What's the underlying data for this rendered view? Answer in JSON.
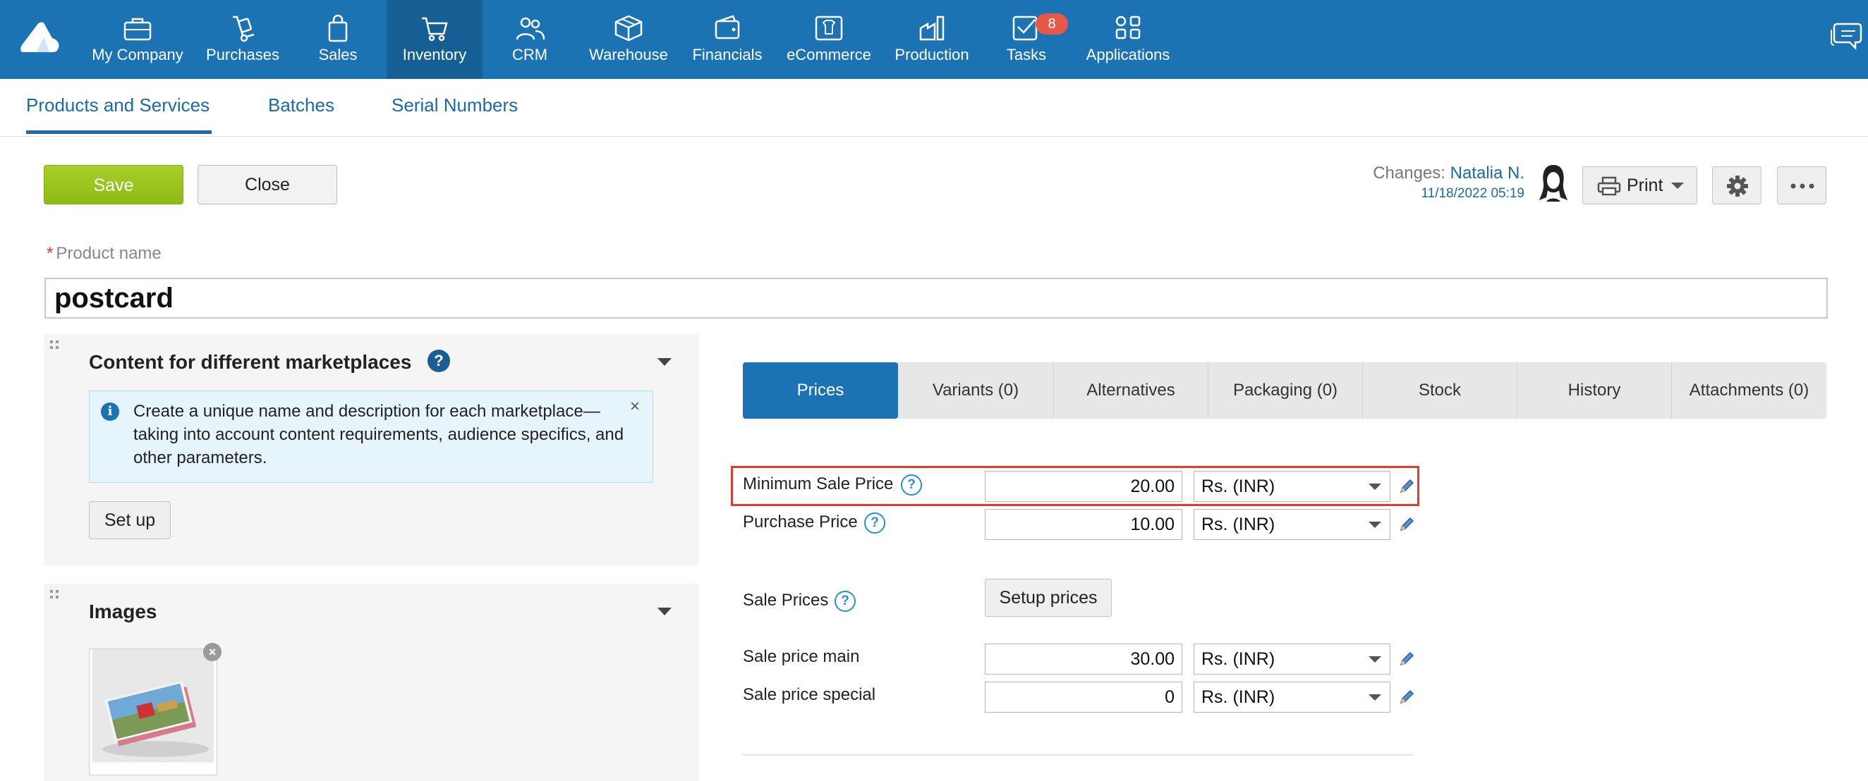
{
  "nav": {
    "items": [
      {
        "label": "My Company",
        "icon": "briefcase-icon"
      },
      {
        "label": "Purchases",
        "icon": "hand-truck-icon"
      },
      {
        "label": "Sales",
        "icon": "shopping-bag-icon"
      },
      {
        "label": "Inventory",
        "icon": "cart-icon",
        "active": true
      },
      {
        "label": "CRM",
        "icon": "people-icon"
      },
      {
        "label": "Warehouse",
        "icon": "box-icon"
      },
      {
        "label": "Financials",
        "icon": "wallet-icon"
      },
      {
        "label": "eCommerce",
        "icon": "storefront-icon"
      },
      {
        "label": "Production",
        "icon": "factory-icon"
      },
      {
        "label": "Tasks",
        "icon": "task-check-icon",
        "badge": "8"
      },
      {
        "label": "Applications",
        "icon": "apps-grid-icon"
      }
    ]
  },
  "subtabs": [
    "Products and Services",
    "Batches",
    "Serial Numbers"
  ],
  "toolbar": {
    "save_label": "Save",
    "close_label": "Close",
    "changes_label": "Changes:",
    "changes_user": "Natalia N.",
    "changes_date": "11/18/2022 05:19",
    "print_label": "Print"
  },
  "product": {
    "name_label": "Product name",
    "name_value": "postcard"
  },
  "marketplaces": {
    "title": "Content for different marketplaces",
    "help": "?",
    "info": "Create a unique name and description for each marketplace—taking into account content requirements, audience specifics, and other parameters.",
    "close": "×",
    "setup_label": "Set up"
  },
  "images": {
    "title": "Images",
    "remove": "×"
  },
  "tabs": [
    "Prices",
    "Variants (0)",
    "Alternatives",
    "Packaging (0)",
    "Stock",
    "History",
    "Attachments (0)"
  ],
  "prices": {
    "help": "?",
    "min_sale": {
      "label": "Minimum Sale Price",
      "value": "20.00",
      "currency": "Rs. (INR)"
    },
    "purchase": {
      "label": "Purchase Price",
      "value": "10.00",
      "currency": "Rs. (INR)"
    },
    "sale_prices_label": "Sale Prices",
    "setup_prices_label": "Setup prices",
    "sale_main": {
      "label": "Sale price main",
      "value": "30.00",
      "currency": "Rs. (INR)"
    },
    "sale_special": {
      "label": "Sale price special",
      "value": "0",
      "currency": "Rs. (INR)"
    }
  },
  "colors": {
    "nav_bg": "#1b73b3",
    "save_green": "#9cc41f",
    "highlight_red": "#e23a2d",
    "badge_red": "#e55a47"
  }
}
